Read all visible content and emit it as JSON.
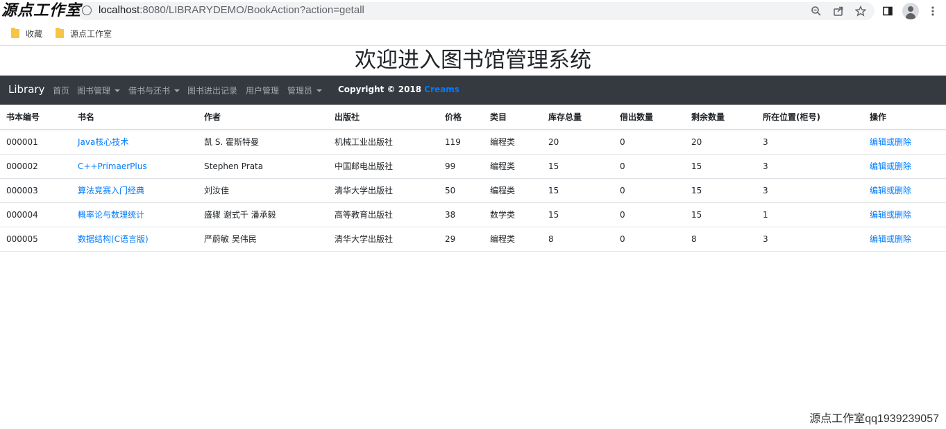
{
  "browser": {
    "watermark": "源点工作室",
    "url_host": "localhost",
    "url_rest": ":8080/LIBRARYDEMO/BookAction?action=getall",
    "icons": [
      "zoom-icon",
      "share-icon",
      "star-icon",
      "sidepanel-icon",
      "profile-icon",
      "menu-icon"
    ]
  },
  "bookmarks": [
    {
      "label": "收藏"
    },
    {
      "label": "源点工作室"
    }
  ],
  "page": {
    "title": "欢迎进入图书馆管理系统"
  },
  "navbar": {
    "brand": "Library",
    "items": [
      {
        "label": "首页"
      },
      {
        "label": "图书管理"
      },
      {
        "label": "借书与还书"
      },
      {
        "label": "图书进出记录"
      },
      {
        "label": "用户管理"
      },
      {
        "label": "管理员"
      }
    ],
    "copyright_prefix": "Copyright © 2018 ",
    "copyright_link": "Creams"
  },
  "table": {
    "headers": [
      "书本编号",
      "书名",
      "作者",
      "出版社",
      "价格",
      "类目",
      "库存总量",
      "借出数量",
      "剩余数量",
      "所在位置(柜号)",
      "操作"
    ],
    "rows": [
      {
        "id": "000001",
        "name": "Java核心技术",
        "author": "凯 S. 霍斯特曼",
        "publisher": "机械工业出版社",
        "price": "119",
        "category": "编程类",
        "stock": "20",
        "borrowed": "0",
        "remaining": "20",
        "location": "3",
        "action": "编辑或删除"
      },
      {
        "id": "000002",
        "name": "C++PrimaerPlus",
        "author": "Stephen Prata",
        "publisher": "中国邮电出版社",
        "price": "99",
        "category": "编程类",
        "stock": "15",
        "borrowed": "0",
        "remaining": "15",
        "location": "3",
        "action": "编辑或删除"
      },
      {
        "id": "000003",
        "name": "算法竞赛入门经典",
        "author": "刘汝佳",
        "publisher": "清华大学出版社",
        "price": "50",
        "category": "编程类",
        "stock": "15",
        "borrowed": "0",
        "remaining": "15",
        "location": "3",
        "action": "编辑或删除"
      },
      {
        "id": "000004",
        "name": "概率论与数理统计",
        "author": "盛骤 谢式千 潘承毅",
        "publisher": "高等教育出版社",
        "price": "38",
        "category": "数学类",
        "stock": "15",
        "borrowed": "0",
        "remaining": "15",
        "location": "1",
        "action": "编辑或删除"
      },
      {
        "id": "000005",
        "name": "数据结构(C语言版)",
        "author": "严蔚敏 吴伟民",
        "publisher": "清华大学出版社",
        "price": "29",
        "category": "编程类",
        "stock": "8",
        "borrowed": "0",
        "remaining": "8",
        "location": "3",
        "action": "编辑或删除"
      }
    ]
  },
  "footer": {
    "watermark": "源点工作室qq1939239057"
  }
}
